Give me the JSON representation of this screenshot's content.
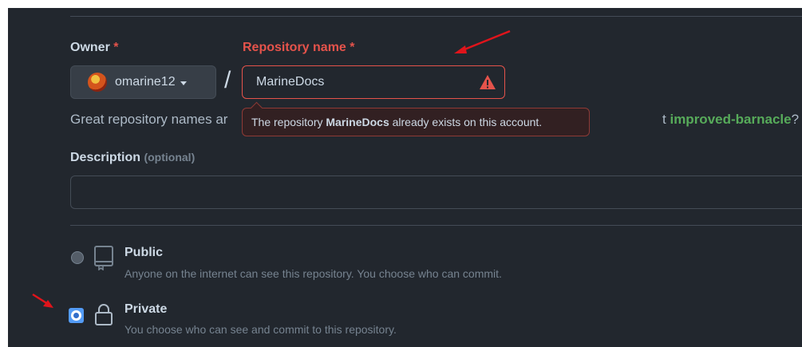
{
  "owner": {
    "label": "Owner",
    "required_mark": "*",
    "selected": "omarine12"
  },
  "repository": {
    "label": "Repository name",
    "required_mark": "*",
    "value": "MarineDocs",
    "separator": "/"
  },
  "hint": {
    "prefix": "Great repository names ar",
    "suggestion": "improved-barnacle",
    "suffix": "?",
    "suggestion_lead": "t"
  },
  "tooltip": {
    "prefix": "The repository ",
    "repo": "MarineDocs",
    "suffix": " already exists on this account."
  },
  "description": {
    "label": "Description",
    "optional": "(optional)",
    "value": ""
  },
  "visibility": {
    "public": {
      "title": "Public",
      "description": "Anyone on the internet can see this repository. You choose who can commit.",
      "icon": "repo-icon",
      "selected": false
    },
    "private": {
      "title": "Private",
      "description": "You choose who can see and commit to this repository.",
      "icon": "lock-icon",
      "selected": true
    }
  },
  "colors": {
    "background": "#22272e",
    "error": "#e5534b",
    "accent": "#539bf5",
    "success": "#57ab5a",
    "annotation_arrow": "#e0141b"
  }
}
